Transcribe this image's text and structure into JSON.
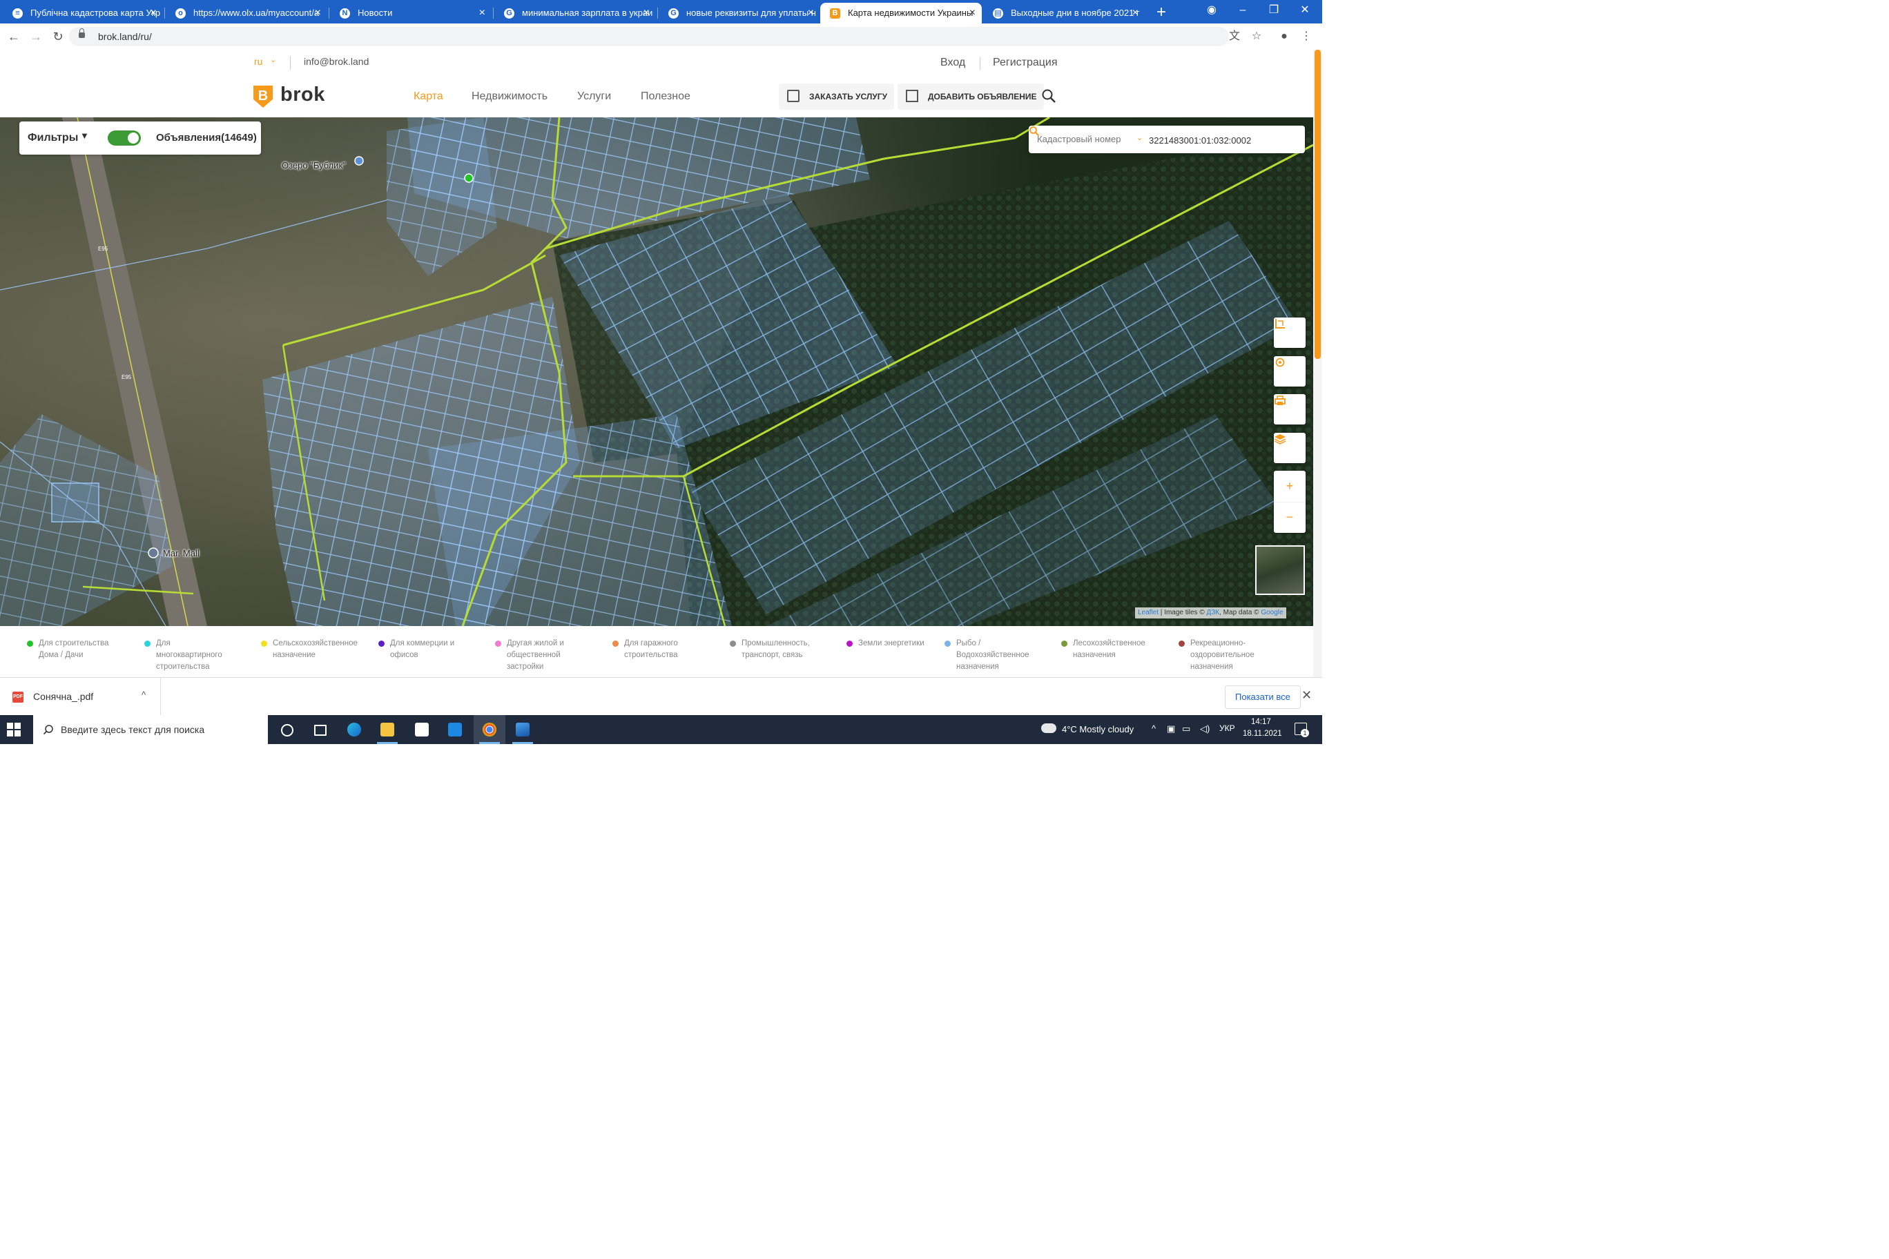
{
  "browser": {
    "tabs": [
      {
        "title": "Публічна кадастрова карта Укр",
        "icon": "ukraine-flag-icon",
        "active": false
      },
      {
        "title": "https://www.olx.ua/myaccount/a",
        "icon": "olx-icon",
        "active": false
      },
      {
        "title": "Новости",
        "icon": "news-icon",
        "active": false
      },
      {
        "title": "минимальная зарплата в украи",
        "icon": "google-icon",
        "active": false
      },
      {
        "title": "новые реквизиты для уплаты н",
        "icon": "google-icon",
        "active": false
      },
      {
        "title": "Карта недвижимости Украины",
        "icon": "brok-icon",
        "active": true
      },
      {
        "title": "Выходные дни в ноябре 2021 г",
        "icon": "document-icon",
        "active": false
      }
    ],
    "url": "brok.land/ru/"
  },
  "site": {
    "lang": "ru",
    "email": "info@brok.land",
    "login": "Вход",
    "register": "Регистрация",
    "logo": "brok",
    "nav": [
      "Карта",
      "Недвижимость",
      "Услуги",
      "Полезное"
    ],
    "order_service": "ЗАКАЗАТЬ УСЛУГУ",
    "add_listing": "ДОБАВИТЬ ОБЪЯВЛЕНИЕ"
  },
  "map": {
    "filters_label": "Фильтры",
    "ads_toggle_on": true,
    "ads_label": "Объявления(14649)",
    "search_type": "Кадастровый номер",
    "search_value": "3221483001:01:032:0002",
    "labels": {
      "lake": "Озеро \"Бублик\"",
      "mall": "Mar. Mall",
      "road1": "Е95",
      "road2": "Е95"
    },
    "attribution": {
      "leaflet": "Leaflet",
      "image_tiles": "Image tiles ©",
      "dzk": "ДЗК",
      "map_data": ", Map data ©",
      "google": "Google"
    },
    "zoom_in": "+",
    "zoom_out": "−"
  },
  "legend": [
    {
      "label": "Для строительства Дома / Дачи",
      "color": "#22c42a"
    },
    {
      "label": "Для многоквартирного строительства",
      "color": "#27d4d9"
    },
    {
      "label": "Сельскохозяйственное назначение",
      "color": "#f2e21d"
    },
    {
      "label": "Для коммерции и офисов",
      "color": "#5a1fc7"
    },
    {
      "label": "Другая жилой и общественной застройки",
      "color": "#ee7bd5"
    },
    {
      "label": "Для гаражного строительства",
      "color": "#f08a4b"
    },
    {
      "label": "Промышленность, транспорт, связь",
      "color": "#8c8c8c"
    },
    {
      "label": "Земли энергетики",
      "color": "#b815c9"
    },
    {
      "label": "Рыбо / Водохозяйственное назначения",
      "color": "#7fb3e6"
    },
    {
      "label": "Лесохозяйственное назначения",
      "color": "#7a9a3a"
    },
    {
      "label": "Рекреационно-оздоровительное назначения",
      "color": "#a7433c"
    }
  ],
  "downloads": {
    "file": "Сонячна_.pdf",
    "show_all": "Показати все"
  },
  "taskbar": {
    "search_placeholder": "Введите здесь текст для поиска",
    "weather": "4°C  Mostly cloudy",
    "lang": "УКР",
    "time": "14:17",
    "date": "18.11.2021",
    "notifications": "1"
  }
}
